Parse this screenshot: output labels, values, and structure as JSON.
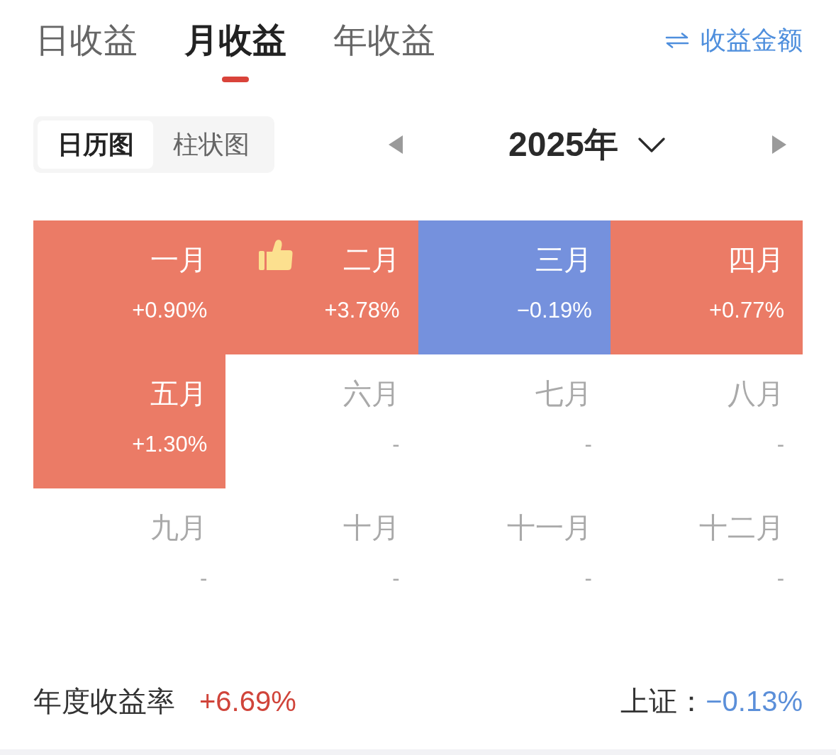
{
  "tabs": [
    {
      "label": "日收益",
      "selected": false
    },
    {
      "label": "月收益",
      "selected": true
    },
    {
      "label": "年收益",
      "selected": false
    }
  ],
  "switch_link": {
    "label": "收益金额"
  },
  "view_switch": [
    {
      "label": "日历图",
      "selected": true
    },
    {
      "label": "柱状图",
      "selected": false
    }
  ],
  "year_picker": {
    "label": "2025年"
  },
  "months": [
    {
      "label": "一月",
      "value": "+0.90%",
      "color": "#eb7b66",
      "best": false
    },
    {
      "label": "二月",
      "value": "+3.78%",
      "color": "#eb7b66",
      "best": true
    },
    {
      "label": "三月",
      "value": "−0.19%",
      "color": "#7591dd",
      "best": false
    },
    {
      "label": "四月",
      "value": "+0.77%",
      "color": "#eb7b66",
      "best": false
    },
    {
      "label": "五月",
      "value": "+1.30%",
      "color": "#eb7b66",
      "best": false
    },
    {
      "label": "六月",
      "value": "-",
      "best": false
    },
    {
      "label": "七月",
      "value": "-",
      "best": false
    },
    {
      "label": "八月",
      "value": "-",
      "best": false
    },
    {
      "label": "九月",
      "value": "-",
      "best": false
    },
    {
      "label": "十月",
      "value": "-",
      "best": false
    },
    {
      "label": "十一月",
      "value": "-",
      "best": false
    },
    {
      "label": "十二月",
      "value": "-",
      "best": false
    }
  ],
  "summary": {
    "label": "年度收益率",
    "value": "+6.69%",
    "index_label": "上证：",
    "index_value": "−0.13%"
  }
}
